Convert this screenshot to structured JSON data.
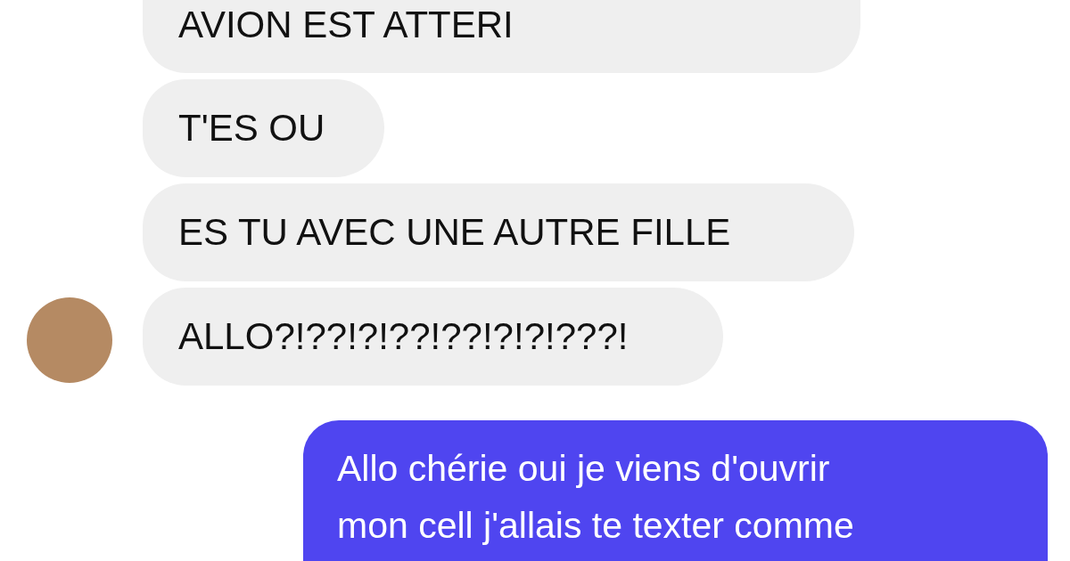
{
  "messages": [
    {
      "kind": "received",
      "text": "AVION EST ATTERI",
      "avatar": false
    },
    {
      "kind": "received",
      "text": "T'ES OU",
      "avatar": false
    },
    {
      "kind": "received",
      "text": "ES TU AVEC UNE AUTRE FILLE",
      "avatar": false
    },
    {
      "kind": "received",
      "text": "ALLO?!??!?!??!??!?!?!???!",
      "avatar": true
    },
    {
      "kind": "sent",
      "lines": [
        "Allo chérie oui je viens d'ouvrir",
        "mon cell j'allais te texter comme"
      ]
    }
  ]
}
